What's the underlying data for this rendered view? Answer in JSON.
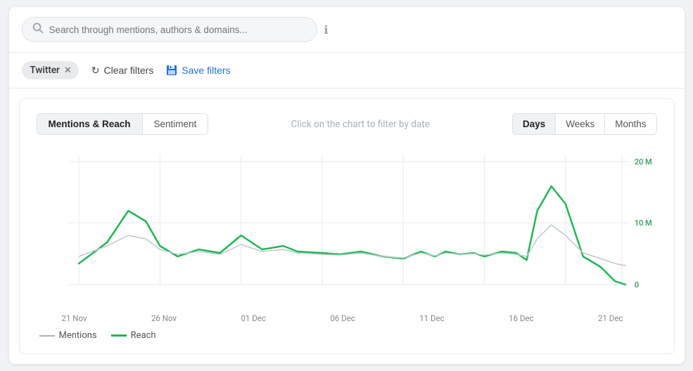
{
  "search": {
    "placeholder": "Search through mentions, authors & domains..."
  },
  "filters": {
    "active_filter": "Twitter",
    "clear_label": "Clear filters",
    "save_label": "Save filters"
  },
  "chart": {
    "tabs": [
      {
        "id": "mentions-reach",
        "label": "Mentions & Reach",
        "active": true
      },
      {
        "id": "sentiment",
        "label": "Sentiment",
        "active": false
      }
    ],
    "hint": "Click on the chart to filter by date",
    "period_tabs": [
      {
        "id": "days",
        "label": "Days",
        "active": true
      },
      {
        "id": "weeks",
        "label": "Weeks",
        "active": false
      },
      {
        "id": "months",
        "label": "Months",
        "active": false
      }
    ],
    "y_labels": [
      "20 M",
      "10 M",
      "0"
    ],
    "x_labels": [
      "21 Nov",
      "26 Nov",
      "01 Dec",
      "06 Dec",
      "11 Dec",
      "16 Dec",
      "21 Dec"
    ],
    "legend": [
      {
        "id": "mentions",
        "label": "Mentions",
        "color": "#aab0bb"
      },
      {
        "id": "reach",
        "label": "Reach",
        "color": "#1db954"
      }
    ]
  }
}
